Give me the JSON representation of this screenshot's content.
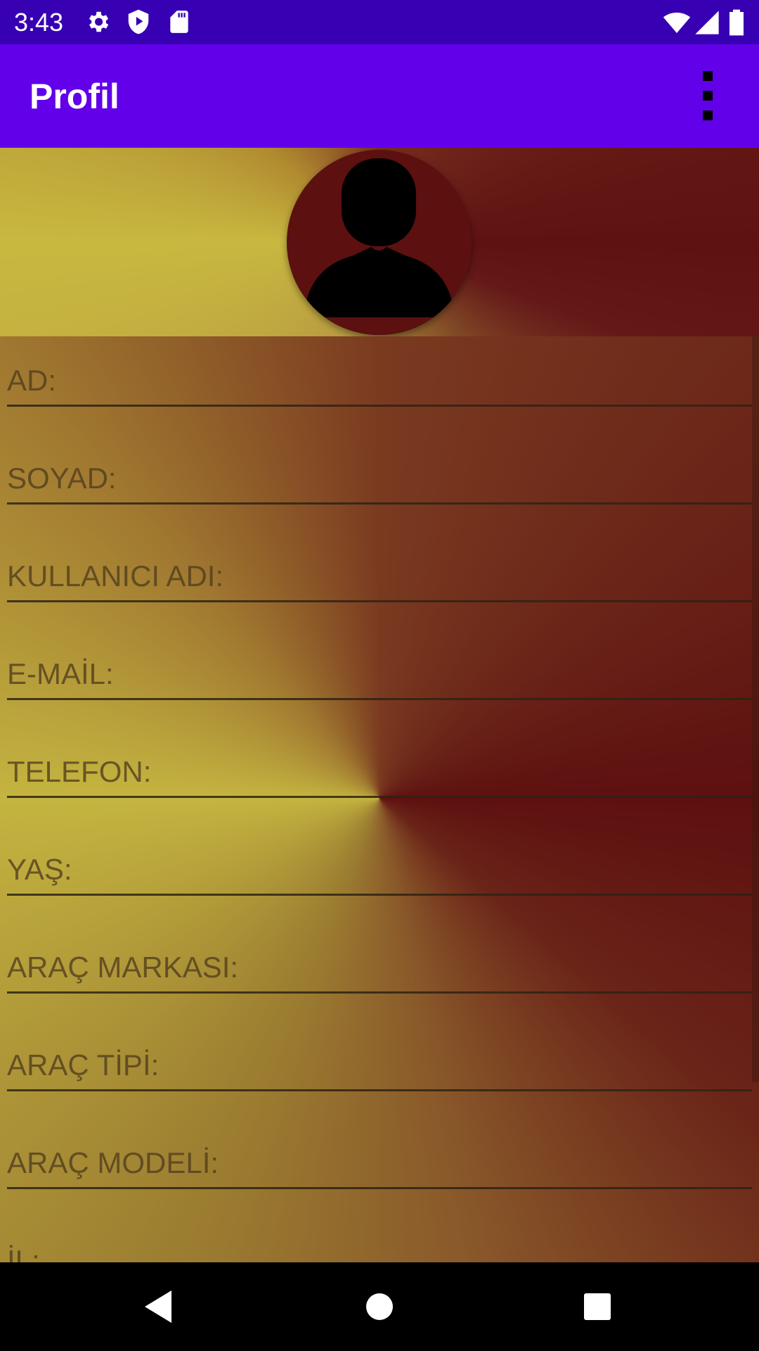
{
  "status_bar": {
    "time": "3:43",
    "left_icons": [
      "gear-icon",
      "play-shield-icon",
      "sd-card-icon"
    ],
    "right_icons": [
      "wifi-icon",
      "cellular-signal-icon",
      "battery-icon"
    ]
  },
  "app_bar": {
    "title": "Profil",
    "menu_icon": "more-vert-icon"
  },
  "header": {
    "avatar_icon": "person-silhouette-icon"
  },
  "form": {
    "fields": [
      {
        "label": "AD:"
      },
      {
        "label": "SOYAD:"
      },
      {
        "label": "KULLANICI ADI:"
      },
      {
        "label": "E-MAİL:"
      },
      {
        "label": "TELEFON:"
      },
      {
        "label": "YAŞ:"
      },
      {
        "label": "ARAÇ MARKASI:"
      },
      {
        "label": "ARAÇ TİPİ:"
      },
      {
        "label": "ARAÇ MODELİ:"
      },
      {
        "label": "İL:"
      }
    ]
  },
  "nav_bar": {
    "back_icon": "back-triangle-icon",
    "home_icon": "home-circle-icon",
    "recents_icon": "recents-square-icon"
  },
  "colors": {
    "status_bar": "#3700b3",
    "app_bar": "#6200ea",
    "gradient_light": "#c8b840",
    "gradient_dark": "#5e1010"
  }
}
